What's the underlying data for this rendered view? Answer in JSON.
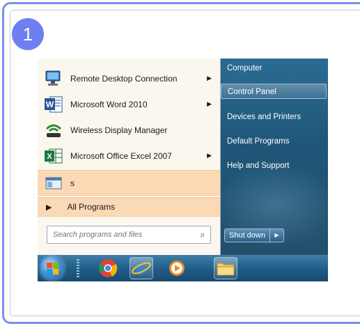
{
  "step": {
    "number": "1",
    "color": "#6f7ff2"
  },
  "start_menu": {
    "programs": [
      {
        "label": "Remote Desktop Connection",
        "icon": "remote-desktop-icon",
        "has_submenu": true
      },
      {
        "label": "Microsoft Word 2010",
        "icon": "word-icon",
        "has_submenu": true
      },
      {
        "label": "Wireless Display Manager",
        "icon": "wireless-display-icon",
        "has_submenu": false
      },
      {
        "label": "Microsoft Office Excel 2007",
        "icon": "excel-icon",
        "has_submenu": true
      },
      {
        "label": "s",
        "icon": "app-window-icon",
        "has_submenu": false,
        "highlighted": true
      }
    ],
    "all_programs": "All Programs",
    "search_placeholder": "Search programs and files",
    "right_items": [
      {
        "label": "Computer"
      },
      {
        "label": "Control Panel",
        "selected": true
      },
      {
        "label": "Devices and Printers"
      },
      {
        "label": "Default Programs"
      },
      {
        "label": "Help and Support"
      }
    ],
    "shutdown_label": "Shut down",
    "submenu_arrow": "▶",
    "shutdown_arrow": "▶",
    "search_icon": "⌕"
  },
  "taskbar": {
    "buttons": [
      {
        "icon": "chrome-icon"
      },
      {
        "icon": "internet-explorer-icon",
        "active": true
      },
      {
        "icon": "media-player-icon"
      },
      {
        "icon": "folder-icon"
      }
    ]
  }
}
